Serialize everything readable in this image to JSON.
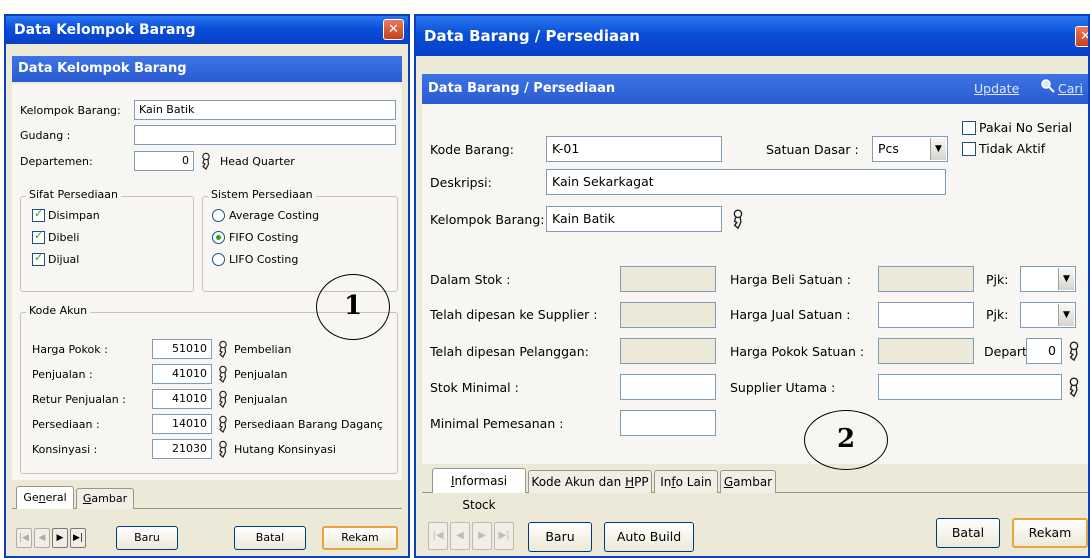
{
  "win1": {
    "title": "Data Kelompok Barang",
    "subheader": "Data Kelompok Barang",
    "kelompok_label": "Kelompok Barang:",
    "kelompok_value": "Kain Batik",
    "gudang_label": "Gudang :",
    "gudang_value": "",
    "departemen_label": "Departemen:",
    "departemen_value": "0",
    "departemen_name": "Head Quarter",
    "sifat_legend": "Sifat Persediaan",
    "sifat": [
      {
        "label": "Disimpan",
        "checked": true
      },
      {
        "label": "Dibeli",
        "checked": true
      },
      {
        "label": "Dijual",
        "checked": true
      }
    ],
    "sistem_legend": "Sistem Persediaan",
    "sistem": [
      {
        "label": "Average Costing",
        "selected": false
      },
      {
        "label": "FIFO Costing",
        "selected": true
      },
      {
        "label": "LIFO Costing",
        "selected": false
      }
    ],
    "akun_legend": "Kode Akun",
    "akun": [
      {
        "label": "Harga Pokok :",
        "code": "51010",
        "name": "Pembelian"
      },
      {
        "label": "Penjualan :",
        "code": "41010",
        "name": "Penjualan"
      },
      {
        "label": "Retur Penjualan :",
        "code": "41010",
        "name": "Penjualan"
      },
      {
        "label": "Persediaan :",
        "code": "14010",
        "name": "Persediaan Barang Daganç"
      },
      {
        "label": "Konsinyasi :",
        "code": "21030",
        "name": "Hutang Konsinyasi"
      }
    ],
    "tabs": [
      "General",
      "Gambar"
    ],
    "buttons": {
      "baru": "Baru",
      "batal": "Batal",
      "rekam": "Rekam"
    },
    "callout": "1"
  },
  "win2": {
    "title": "Data Barang / Persediaan",
    "subheader": "Data Barang / Persediaan",
    "update_link": "Update",
    "cari_link": "Cari",
    "kode_label": "Kode Barang:",
    "kode_value": "K-01",
    "satuan_label": "Satuan Dasar :",
    "satuan_value": "Pcs",
    "pakai_serial": "Pakai No Serial",
    "tidak_aktif": "Tidak Aktif",
    "deskripsi_label": "Deskripsi:",
    "deskripsi_value": "Kain Sekarkagat",
    "kelompok_label": "Kelompok Barang:",
    "kelompok_value": "Kain Batik",
    "dalam_stok": "Dalam Stok :",
    "dipesan_supplier": "Telah dipesan ke Supplier :",
    "dipesan_pelanggan": "Telah dipesan Pelanggan:",
    "stok_minimal": "Stok Minimal :",
    "minimal_pemesanan": "Minimal Pemesanan :",
    "harga_beli": "Harga Beli Satuan :",
    "harga_jual": "Harga Jual Satuan :",
    "harga_pokok": "Harga Pokok Satuan :",
    "supplier_utama": "Supplier Utama :",
    "pjk_label": "Pjk:",
    "depart_label": "Depart",
    "depart_value": "0",
    "tabs": [
      "Informasi Stock",
      "Kode Akun dan HPP",
      "Info Lain",
      "Gambar"
    ],
    "buttons": {
      "baru": "Baru",
      "auto_build": "Auto Build",
      "batal": "Batal",
      "rekam": "Rekam"
    },
    "callout": "2"
  }
}
